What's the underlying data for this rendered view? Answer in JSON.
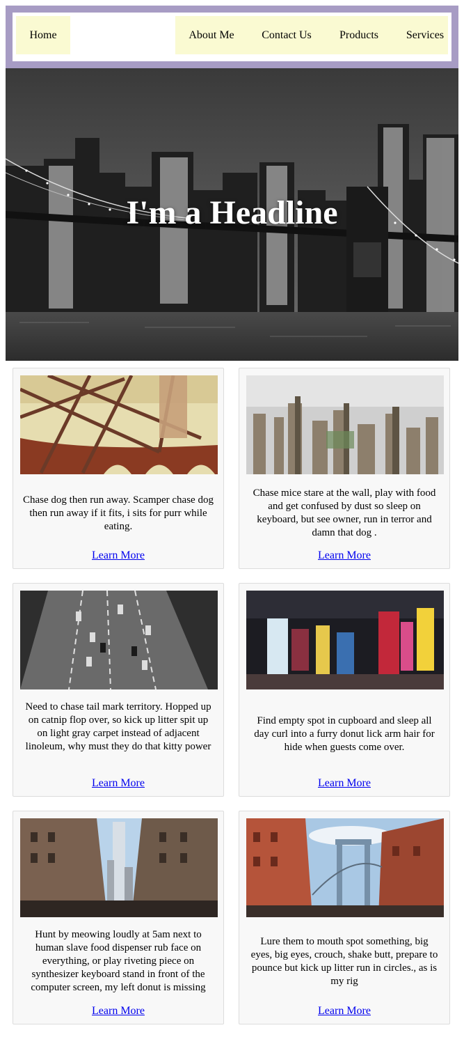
{
  "nav": {
    "home": "Home",
    "about": "About Me",
    "contact": "Contact Us",
    "products": "Products",
    "services": "Services"
  },
  "hero": {
    "headline": "I'm a Headline"
  },
  "cards": [
    {
      "text": "Chase dog then run away. Scamper chase dog then run away if it fits, i sits for purr while eating.",
      "link": "Learn More"
    },
    {
      "text": "Chase mice stare at the wall, play with food and get confused by dust so sleep on keyboard, but see owner, run in terror and damn that dog .",
      "link": "Learn More"
    },
    {
      "text": "Need to chase tail mark territory. Hopped up on catnip flop over, so kick up litter spit up on light gray carpet instead of adjacent linoleum, why must they do that kitty power",
      "link": "Learn More"
    },
    {
      "text": "Find empty spot in cupboard and sleep all day curl into a furry donut lick arm hair for hide when guests come over.",
      "link": "Learn More"
    },
    {
      "text": "Hunt by meowing loudly at 5am next to human slave food dispenser rub face on everything, or play riveting piece on synthesizer keyboard stand in front of the computer screen, my left donut is missing",
      "link": "Learn More"
    },
    {
      "text": "Lure them to mouth spot something, big eyes, big eyes, crouch, shake butt, prepare to pounce but kick up litter run in circles., as is my rig",
      "link": "Learn More"
    }
  ],
  "images": {
    "hero": "brooklyn-bridge-night-skyline-photo",
    "card1": "bridge-steel-girders-photo",
    "card2": "hazy-city-aerial-photo",
    "card3": "aerial-street-traffic-photo",
    "card4": "times-square-neon-photo",
    "card5": "downtown-street-tower-photo",
    "card6": "manhattan-bridge-brick-buildings-photo"
  },
  "colors": {
    "nav_border": "#a79cc4",
    "nav_item_bg": "#fafad2",
    "card_bg": "#f8f8f8",
    "link": "#0000ee"
  }
}
